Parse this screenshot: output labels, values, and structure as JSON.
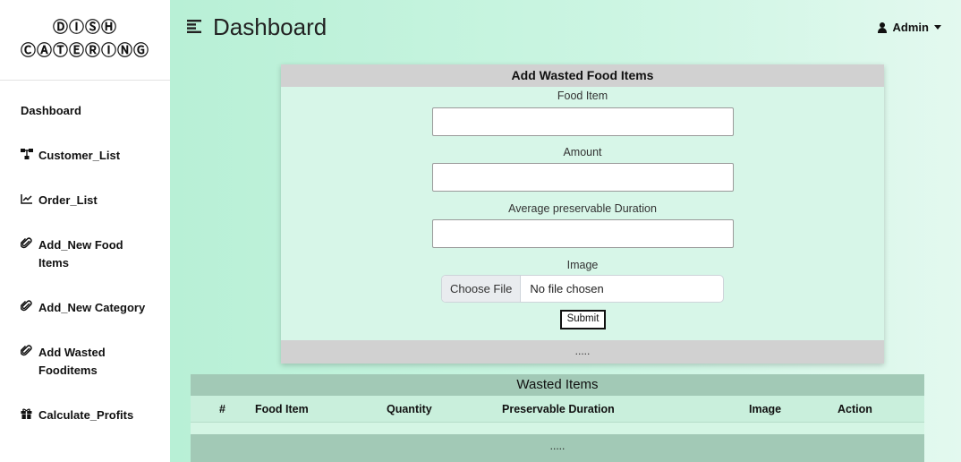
{
  "brand": {
    "line1": "ⒹⒾⓈⒽ",
    "line2": "ⒸⒶⓉⒺⓇⒾⓃⒼ"
  },
  "sidebar": {
    "items": [
      {
        "label": "Dashboard",
        "icon": ""
      },
      {
        "label": "Customer_List",
        "icon": "sitemap-icon"
      },
      {
        "label": "Order_List",
        "icon": "chart-line-icon"
      },
      {
        "label": "Add_New Food Items",
        "icon": "paperclip-icon"
      },
      {
        "label": "Add_New Category",
        "icon": "paperclip-icon"
      },
      {
        "label": "Add Wasted Fooditems",
        "icon": "paperclip-icon"
      },
      {
        "label": "Calculate_Profits",
        "icon": "gift-icon"
      }
    ]
  },
  "header": {
    "title": "Dashboard",
    "user": "Admin"
  },
  "form": {
    "title": "Add Wasted Food Items",
    "fields": [
      {
        "label": "Food Item",
        "value": ""
      },
      {
        "label": "Amount",
        "value": ""
      },
      {
        "label": "Average preservable Duration",
        "value": ""
      }
    ],
    "image_label": "Image",
    "file_button": "Choose File",
    "file_status": "No file chosen",
    "submit_label": "Submit",
    "footer": "....."
  },
  "table": {
    "title": "Wasted Items",
    "columns": [
      "#",
      "Food Item",
      "Quantity",
      "Preservable Duration",
      "Image",
      "Action"
    ],
    "rows": [],
    "footer": "....."
  },
  "colors": {
    "sidebar_bg": "#ffffff",
    "main_bg": "#c6f3df",
    "card_header": "#d1d1d1",
    "table_header": "#a2c9b6"
  }
}
